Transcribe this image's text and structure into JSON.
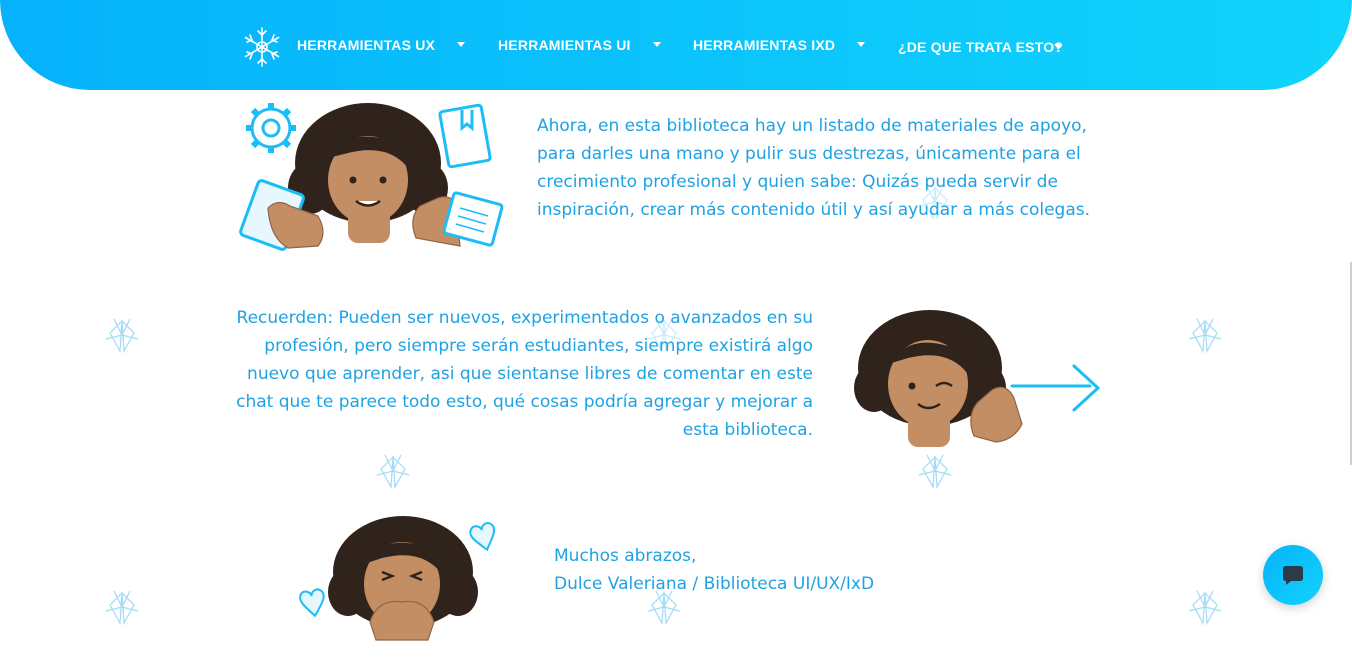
{
  "nav": {
    "items": [
      {
        "label": "HERRAMIENTAS UX"
      },
      {
        "label": "HERRAMIENTAS UI"
      },
      {
        "label": "HERRAMIENTAS IXD"
      },
      {
        "label": "¿DE QUE TRATA ESTO?"
      }
    ]
  },
  "sections": {
    "intro": "Ahora, en esta biblioteca hay un listado de materiales de apoyo, para darles una mano y pulir sus destrezas, únicamente para el crecimiento profesional y quien sabe: Quizás pueda servir de inspiración, crear más contenido útil y así ayudar a más colegas.",
    "reminder": "Recuerden: Pueden ser nuevos, experimentados o avanzados en su profesión, pero siempre serán estudiantes, siempre existirá algo nuevo que aprender, asi que sientanse libres de comentar en este chat que te parece todo esto, qué cosas podría agregar y mejorar a esta biblioteca.",
    "closing_line1": "Muchos abrazos,",
    "closing_line2": "Dulce Valeriana / Biblioteca UI/UX/IxD"
  },
  "colors": {
    "nav_start": "#06b2fb",
    "nav_end": "#10d4fb",
    "text_accent": "#1ea2e3",
    "skin": "#c38e64",
    "hair": "#2f231c"
  },
  "icons": [
    "snowflake-logo-icon",
    "dropdown-caret-icon",
    "gear-icon",
    "book-icon",
    "tablet-icon",
    "notebook-icon",
    "arrow-right-icon",
    "heart-icon",
    "butterfly-icon",
    "chat-bubble-icon"
  ]
}
